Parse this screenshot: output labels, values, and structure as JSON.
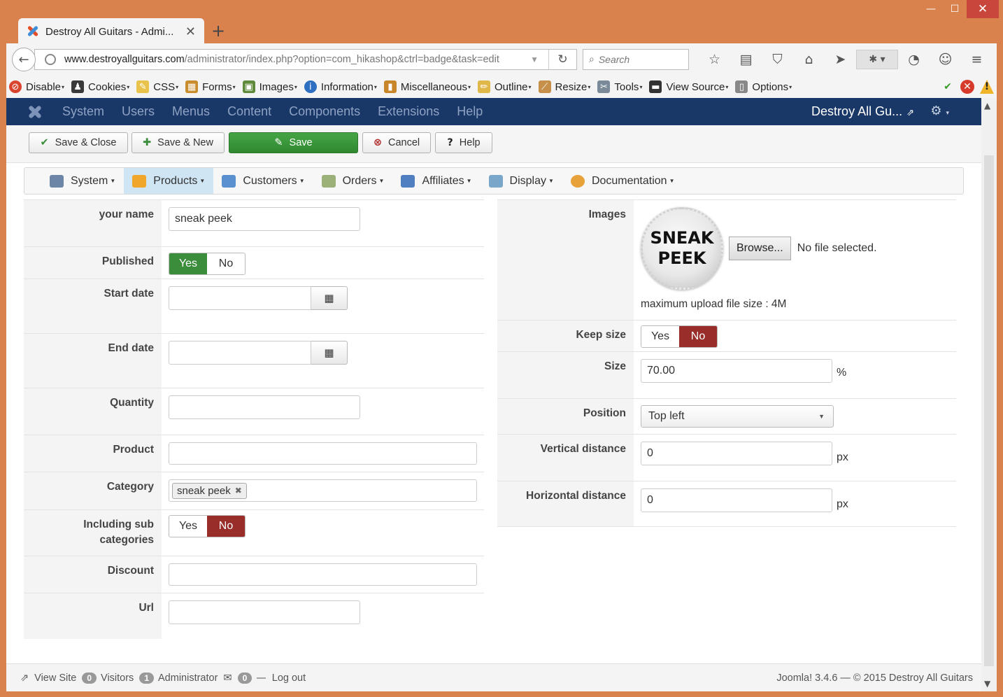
{
  "browser": {
    "tab_title": "Destroy All Guitars - Admi...",
    "url_host": "www.destroyallguitars.com",
    "url_path": "/administrator/index.php?option=com_hikashop&ctrl=badge&task=edit",
    "search_placeholder": "Search"
  },
  "devbar": {
    "items": [
      "Disable",
      "Cookies",
      "CSS",
      "Forms",
      "Images",
      "Information",
      "Miscellaneous",
      "Outline",
      "Resize",
      "Tools",
      "View Source",
      "Options"
    ]
  },
  "admin": {
    "menu": [
      "System",
      "Users",
      "Menus",
      "Content",
      "Components",
      "Extensions",
      "Help"
    ],
    "site_name": "Destroy All Gu..."
  },
  "toolbar": {
    "save_close": "Save & Close",
    "save_new": "Save & New",
    "save": "Save",
    "cancel": "Cancel",
    "help": "Help"
  },
  "hika_menu": [
    "System",
    "Products",
    "Customers",
    "Orders",
    "Affiliates",
    "Display",
    "Documentation"
  ],
  "form_left": {
    "your_name_label": "your name",
    "your_name_value": "sneak peek",
    "published_label": "Published",
    "start_date_label": "Start date",
    "end_date_label": "End date",
    "quantity_label": "Quantity",
    "product_label": "Product",
    "category_label": "Category",
    "category_tag": "sneak peek",
    "including_sub_label_1": "Including sub",
    "including_sub_label_2": "categories",
    "discount_label": "Discount",
    "url_label": "Url",
    "yes": "Yes",
    "no": "No"
  },
  "form_right": {
    "images_label": "Images",
    "badge_line1": "SNEAK",
    "badge_line2": "PEEK",
    "browse": "Browse...",
    "no_file": "No file selected.",
    "max_upload": "maximum upload file size : 4M",
    "keep_size_label": "Keep size",
    "size_label": "Size",
    "size_value": "70.00",
    "size_unit": "%",
    "position_label": "Position",
    "position_value": "Top left",
    "vertical_label": "Vertical distance",
    "vertical_value": "0",
    "horizontal_label": "Horizontal distance",
    "horizontal_value": "0",
    "px": "px",
    "yes": "Yes",
    "no": "No"
  },
  "footer": {
    "view_site": "View Site",
    "visitors_count": "0",
    "visitors": "Visitors",
    "admin_count": "1",
    "administrator": "Administrator",
    "msg_count": "0",
    "logout": "Log out",
    "copyright": "Joomla! 3.4.6  —  © 2015 Destroy All Guitars"
  },
  "colors": {
    "admin_nav": "#1a3867",
    "save_green": "#3b8c3b",
    "no_red": "#982d2a",
    "active_submenu": "#cfe5f4"
  }
}
